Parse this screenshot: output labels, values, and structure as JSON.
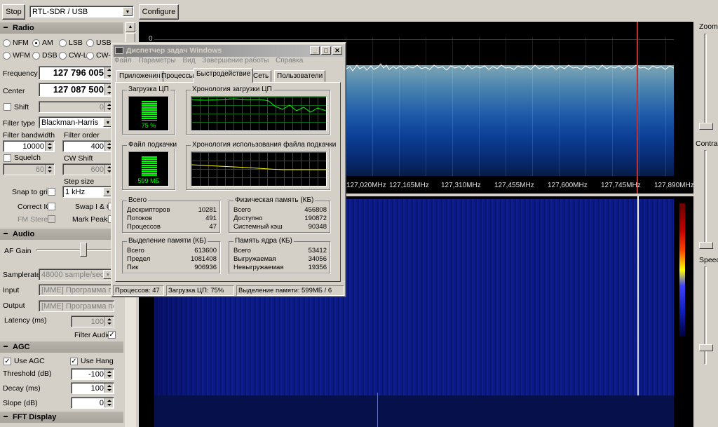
{
  "toolbar": {
    "stop": "Stop",
    "device": "RTL-SDR / USB",
    "configure": "Configure"
  },
  "radio": {
    "header": "Radio",
    "modes_row1": [
      "NFM",
      "AM",
      "LSB",
      "USB"
    ],
    "modes_row2": [
      "WFM",
      "DSB",
      "CW-L",
      "CW-U"
    ],
    "selected_mode": "AM",
    "frequency_label": "Frequency",
    "frequency": "127 796 005",
    "center_label": "Center",
    "center": "127 087 500",
    "shift_label": "Shift",
    "shift": "0",
    "filter_type_label": "Filter type",
    "filter_type": "Blackman-Harris",
    "filter_bandwidth_label": "Filter bandwidth",
    "filter_bandwidth": "10000",
    "filter_order_label": "Filter order",
    "filter_order": "400",
    "squelch_label": "Squelch",
    "squelch": "60",
    "cw_shift_label": "CW Shift",
    "cw_shift": "600",
    "step_size_label": "Step size",
    "snap_label": "Snap to grid",
    "snap_value": "1 kHz",
    "correct_iq": "Correct IQ",
    "swap_iq": "Swap I & Q",
    "fm_stereo": "FM Stereo",
    "mark_peaks": "Mark Peaks"
  },
  "audio": {
    "header": "Audio",
    "af_gain": "AF Gain",
    "samplerate_label": "Samplerate",
    "samplerate": "48000 sample/sec",
    "input_label": "Input",
    "input": "[MME] Программа пер",
    "output_label": "Output",
    "output": "[MME] Программа пер",
    "latency_label": "Latency (ms)",
    "latency": "100",
    "filter_audio": "Filter Audio"
  },
  "agc": {
    "header": "AGC",
    "use_agc": "Use AGC",
    "use_hang": "Use Hang",
    "threshold_label": "Threshold (dB)",
    "threshold": "-100",
    "decay_label": "Decay (ms)",
    "decay": "100",
    "slope_label": "Slope (dB)",
    "slope": "0"
  },
  "fft_header": "FFT Display",
  "right": {
    "zoom": "Zoom",
    "contrast": "Contrast",
    "speed": "Speed"
  },
  "spectrum": {
    "top_tick": "0",
    "freq_labels": [
      "127,020MHz",
      "127,165MHz",
      "127,310MHz",
      "127,455MHz",
      "127,600MHz",
      "127,745MHz",
      "127,890MHz"
    ]
  },
  "taskmgr": {
    "title": "Диспетчер задач Windows",
    "menu": [
      "Файл",
      "Параметры",
      "Вид",
      "Завершение работы",
      "Справка"
    ],
    "tabs": [
      "Приложения",
      "Процессы",
      "Быстродействие",
      "Сеть",
      "Пользователи"
    ],
    "cpu_label": "Загрузка ЦП",
    "cpu_value": "75 %",
    "cpu_hist_label": "Хронология загрузки ЦП",
    "pf_label": "Файл подкачки",
    "pf_value": "599 МБ",
    "pf_hist_label": "Хронология использования файла подкачки",
    "totals": {
      "title": "Всего",
      "rows": [
        [
          "Дескрипторов",
          "10281"
        ],
        [
          "Потоков",
          "491"
        ],
        [
          "Процессов",
          "47"
        ]
      ]
    },
    "physical": {
      "title": "Физическая память (КБ)",
      "rows": [
        [
          "Всего",
          "456808"
        ],
        [
          "Доступно",
          "190872"
        ],
        [
          "Системный кэш",
          "90348"
        ]
      ]
    },
    "commit": {
      "title": "Выделение памяти (КБ)",
      "rows": [
        [
          "Всего",
          "613600"
        ],
        [
          "Предел",
          "1081408"
        ],
        [
          "Пик",
          "906936"
        ]
      ]
    },
    "kernel": {
      "title": "Память ядра (КБ)",
      "rows": [
        [
          "Всего",
          "53412"
        ],
        [
          "Выгружаемая",
          "34056"
        ],
        [
          "Невыгружаемая",
          "19356"
        ]
      ]
    },
    "status": [
      "Процессов: 47",
      "Загрузка ЦП: 75%",
      "Выделение памяти: 599МБ / 6"
    ]
  }
}
